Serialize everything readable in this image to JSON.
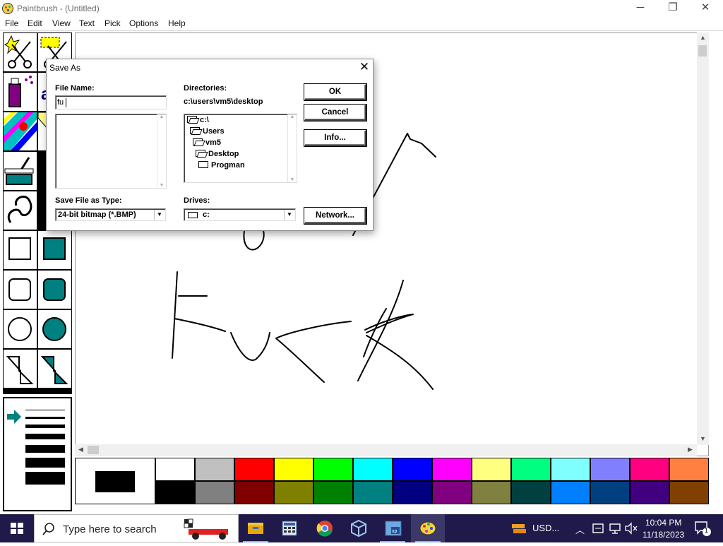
{
  "window": {
    "title": "Paintbrush - (Untitled)",
    "minimize": "─",
    "maximize": "❐",
    "close": "✕"
  },
  "menu": {
    "items": [
      "File",
      "Edit",
      "View",
      "Text",
      "Pick",
      "Options",
      "Help"
    ]
  },
  "drawing": {
    "stroke_color": "#000000",
    "text": "Fuck"
  },
  "palette": {
    "foreground": "#000000",
    "background": "#ffffff",
    "colors_row1": [
      "#ffffff",
      "#c0c0c0",
      "#ff0000",
      "#ffff00",
      "#00ff00",
      "#00ffff",
      "#0000ff",
      "#ff00ff",
      "#ffff80",
      "#00ff80",
      "#80ffff",
      "#8080ff",
      "#ff0080",
      "#ff8040"
    ],
    "colors_row2": [
      "#000000",
      "#808080",
      "#800000",
      "#808000",
      "#008000",
      "#008080",
      "#000080",
      "#800080",
      "#808040",
      "#004040",
      "#0080ff",
      "#004080",
      "#400080",
      "#804000"
    ]
  },
  "dialog": {
    "title": "Save As",
    "close": "✕",
    "file_name_label": "File Name:",
    "file_name_value": "fu",
    "directories_label": "Directories:",
    "current_dir": "c:\\users\\vm5\\desktop",
    "dir_tree": [
      "c:\\",
      "Users",
      "vm5",
      "Desktop",
      "Progman"
    ],
    "save_type_label": "Save File as Type:",
    "save_type_value": "24-bit bitmap (*.BMP)",
    "drives_label": "Drives:",
    "drive_value": "c:",
    "ok": "OK",
    "cancel": "Cancel",
    "info": "Info...",
    "network": "Network..."
  },
  "taskbar": {
    "search_placeholder": "Type here to search",
    "weather": "USD...",
    "time": "10:04 PM",
    "date": "11/18/2023",
    "notifications": "1",
    "accent": "#1f1a4a"
  }
}
